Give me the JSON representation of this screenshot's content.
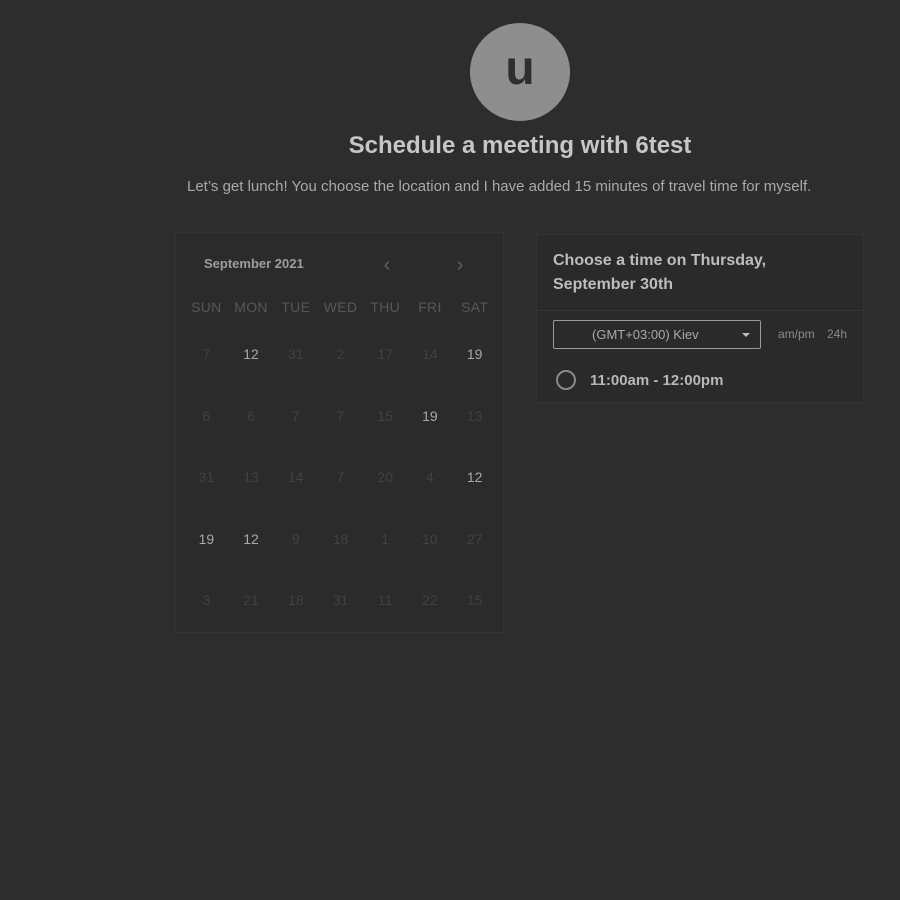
{
  "host": {
    "avatar_initial": "u",
    "title": "Schedule a meeting with 6test",
    "description": "Let’s get lunch! You choose the location and I have added 15 minutes of travel time for myself."
  },
  "calendar": {
    "month_label": "September 2021",
    "prev_icon": "‹",
    "next_icon": "›",
    "weekdays": [
      "SUN",
      "MON",
      "TUE",
      "WED",
      "THU",
      "FRI",
      "SAT"
    ],
    "weeks": [
      [
        {
          "d": "7",
          "a": false
        },
        {
          "d": "12",
          "a": true
        },
        {
          "d": "31",
          "a": false
        },
        {
          "d": "2",
          "a": false
        },
        {
          "d": "17",
          "a": false
        },
        {
          "d": "14",
          "a": false
        },
        {
          "d": "19",
          "a": true
        }
      ],
      [
        {
          "d": "6",
          "a": false
        },
        {
          "d": "6",
          "a": false
        },
        {
          "d": "7",
          "a": false
        },
        {
          "d": "7",
          "a": false
        },
        {
          "d": "15",
          "a": false
        },
        {
          "d": "19",
          "a": true
        },
        {
          "d": "13",
          "a": false
        }
      ],
      [
        {
          "d": "31",
          "a": false
        },
        {
          "d": "13",
          "a": false
        },
        {
          "d": "14",
          "a": false
        },
        {
          "d": "7",
          "a": false
        },
        {
          "d": "20",
          "a": false
        },
        {
          "d": "4",
          "a": false
        },
        {
          "d": "12",
          "a": true
        }
      ],
      [
        {
          "d": "19",
          "a": true
        },
        {
          "d": "12",
          "a": true
        },
        {
          "d": "9",
          "a": false
        },
        {
          "d": "18",
          "a": false
        },
        {
          "d": "1",
          "a": false
        },
        {
          "d": "10",
          "a": false
        },
        {
          "d": "27",
          "a": false
        }
      ],
      [
        {
          "d": "3",
          "a": false
        },
        {
          "d": "21",
          "a": false
        },
        {
          "d": "18",
          "a": false
        },
        {
          "d": "31",
          "a": false
        },
        {
          "d": "11",
          "a": false
        },
        {
          "d": "22",
          "a": false
        },
        {
          "d": "15",
          "a": false
        }
      ]
    ]
  },
  "time_panel": {
    "heading": "Choose a time on Thursday, September 30th",
    "timezone": "(GMT+03:00) Kiev",
    "format_ampm": "am/pm",
    "format_24h": "24h",
    "slots": [
      "11:00am - 12:00pm"
    ]
  },
  "colors": {
    "background": "#2d2d2d",
    "avatar": "#8e8e8e",
    "available_day": "#a8a8a8",
    "unavailable_day": "#414141"
  }
}
